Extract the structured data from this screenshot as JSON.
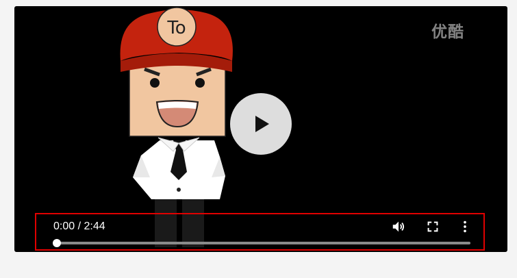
{
  "player": {
    "watermark": "优酷",
    "time_display": "0:00 / 2:44",
    "current_time": "0:00",
    "duration": "2:44",
    "progress_fraction": 0,
    "icons": {
      "play": "play-icon",
      "volume": "volume-icon",
      "fullscreen": "fullscreen-icon",
      "more": "more-vert-icon"
    },
    "cap_text": "To",
    "colors": {
      "highlight_border": "#e00000",
      "cap_red": "#c4230e",
      "skin": "#f1c6a0"
    }
  }
}
